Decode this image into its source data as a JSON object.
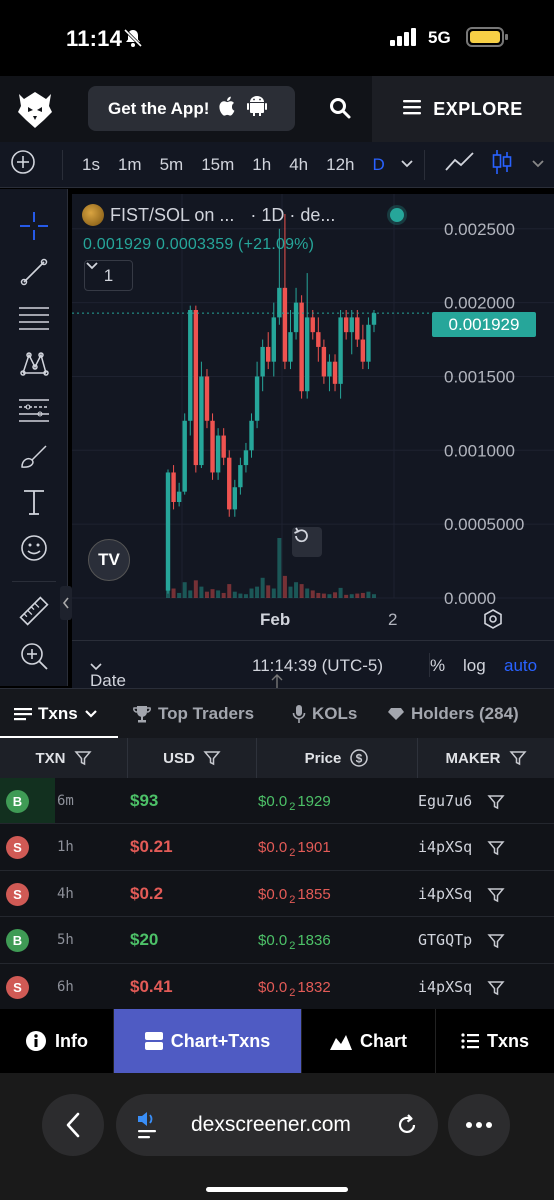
{
  "status_bar": {
    "time": "11:14",
    "network": "5G"
  },
  "header": {
    "get_app_label": "Get the App!",
    "explore_label": "EXPLORE"
  },
  "toolbar": {
    "intervals": [
      "1s",
      "1m",
      "5m",
      "15m",
      "1h",
      "4h",
      "12h",
      "D"
    ],
    "active_interval": "D"
  },
  "chart": {
    "legend_title": "FIST/SOL on ...",
    "legend_rest": "· 1D · de...",
    "ohlc": "0.001929  0.0003359 (+21.09%)",
    "indicators_count": "1",
    "price_tag": "0.001929",
    "date_range_label": "Date Range",
    "clock": "11:14:39 (UTC-5)",
    "pct_label": "%",
    "log_label": "log",
    "auto_label": "auto",
    "accent_up": "#26a69a",
    "accent_down": "#ef5350"
  },
  "chart_data": {
    "type": "candlestick",
    "y_ticks": [
      "0.002500",
      "0.002000",
      "0.001500",
      "0.001000",
      "0.0005000",
      "0.0000"
    ],
    "ylim": [
      0,
      0.0026
    ],
    "x_ticks": [
      "Feb",
      "2"
    ],
    "last_price": 0.001929,
    "candles": [
      [
        5e-05,
        0.00085,
        3e-05,
        0.00087
      ],
      [
        0.00085,
        0.00065,
        0.0006,
        0.0009
      ],
      [
        0.00065,
        0.00072,
        0.00062,
        0.00078
      ],
      [
        0.00072,
        0.0012,
        0.0007,
        0.00125
      ],
      [
        0.0012,
        0.00195,
        0.0011,
        0.00198
      ],
      [
        0.00195,
        0.0009,
        0.00085,
        0.00198
      ],
      [
        0.0009,
        0.0015,
        0.00088,
        0.0016
      ],
      [
        0.0015,
        0.0012,
        0.00115,
        0.00155
      ],
      [
        0.0012,
        0.00085,
        0.0008,
        0.00125
      ],
      [
        0.00085,
        0.0011,
        0.0008,
        0.00115
      ],
      [
        0.0011,
        0.00095,
        0.0009,
        0.00115
      ],
      [
        0.00095,
        0.0006,
        0.00055,
        0.001
      ],
      [
        0.0006,
        0.00075,
        0.00055,
        0.0008
      ],
      [
        0.00075,
        0.0009,
        0.0007,
        0.00095
      ],
      [
        0.0009,
        0.001,
        0.00085,
        0.00105
      ],
      [
        0.001,
        0.0012,
        0.00095,
        0.00125
      ],
      [
        0.0012,
        0.0015,
        0.00115,
        0.0016
      ],
      [
        0.0015,
        0.0017,
        0.0014,
        0.00175
      ],
      [
        0.0017,
        0.0016,
        0.00155,
        0.0018
      ],
      [
        0.0016,
        0.0019,
        0.0015,
        0.002
      ],
      [
        0.0019,
        0.0021,
        0.00185,
        0.0025
      ],
      [
        0.0021,
        0.0016,
        0.00155,
        0.0026
      ],
      [
        0.0016,
        0.0018,
        0.00155,
        0.00195
      ],
      [
        0.0018,
        0.002,
        0.00175,
        0.0021
      ],
      [
        0.002,
        0.0014,
        0.00135,
        0.00205
      ],
      [
        0.0014,
        0.0019,
        0.00135,
        0.0022
      ],
      [
        0.0019,
        0.0018,
        0.00175,
        0.00195
      ],
      [
        0.0018,
        0.0017,
        0.0016,
        0.0019
      ],
      [
        0.0017,
        0.0015,
        0.00145,
        0.00175
      ],
      [
        0.0015,
        0.0016,
        0.0014,
        0.00165
      ],
      [
        0.0016,
        0.00145,
        0.0014,
        0.00165
      ],
      [
        0.00145,
        0.0019,
        0.00135,
        0.00195
      ],
      [
        0.0019,
        0.0018,
        0.00175,
        0.00195
      ],
      [
        0.0018,
        0.0019,
        0.00165,
        0.00195
      ],
      [
        0.0019,
        0.00175,
        0.0017,
        0.00195
      ],
      [
        0.00175,
        0.0016,
        0.00155,
        0.00185
      ],
      [
        0.0016,
        0.00185,
        0.00155,
        0.0019
      ],
      [
        0.00185,
        0.001929,
        0.0018,
        0.00195
      ]
    ],
    "volumes": [
      0.35,
      0.15,
      0.08,
      0.25,
      0.12,
      0.28,
      0.18,
      0.1,
      0.14,
      0.12,
      0.08,
      0.22,
      0.1,
      0.07,
      0.06,
      0.15,
      0.18,
      0.32,
      0.2,
      0.15,
      0.95,
      0.35,
      0.18,
      0.25,
      0.22,
      0.15,
      0.12,
      0.08,
      0.07,
      0.06,
      0.09,
      0.16,
      0.05,
      0.06,
      0.07,
      0.08,
      0.1,
      0.06
    ]
  },
  "tabs": [
    "Txns",
    "Top Traders",
    "KOLs",
    "Holders (284)"
  ],
  "table": {
    "headers": [
      "TXN",
      "USD",
      "Price",
      "MAKER"
    ],
    "rows": [
      {
        "type": "B",
        "age": "6m",
        "usd": "$93",
        "price_prefix": "$0.0",
        "price_sub": "2",
        "price_rest": "1929",
        "maker": "Egu7u6"
      },
      {
        "type": "S",
        "age": "1h",
        "usd": "$0.21",
        "price_prefix": "$0.0",
        "price_sub": "2",
        "price_rest": "1901",
        "maker": "i4pXSq"
      },
      {
        "type": "S",
        "age": "4h",
        "usd": "$0.2",
        "price_prefix": "$0.0",
        "price_sub": "2",
        "price_rest": "1855",
        "maker": "i4pXSq"
      },
      {
        "type": "B",
        "age": "5h",
        "usd": "$20",
        "price_prefix": "$0.0",
        "price_sub": "2",
        "price_rest": "1836",
        "maker": "GTGQTp"
      },
      {
        "type": "S",
        "age": "6h",
        "usd": "$0.41",
        "price_prefix": "$0.0",
        "price_sub": "2",
        "price_rest": "1832",
        "maker": "i4pXSq"
      }
    ]
  },
  "bottom_nav": [
    "Info",
    "Chart+Txns",
    "Chart",
    "Txns"
  ],
  "browser": {
    "url": "dexscreener.com"
  }
}
